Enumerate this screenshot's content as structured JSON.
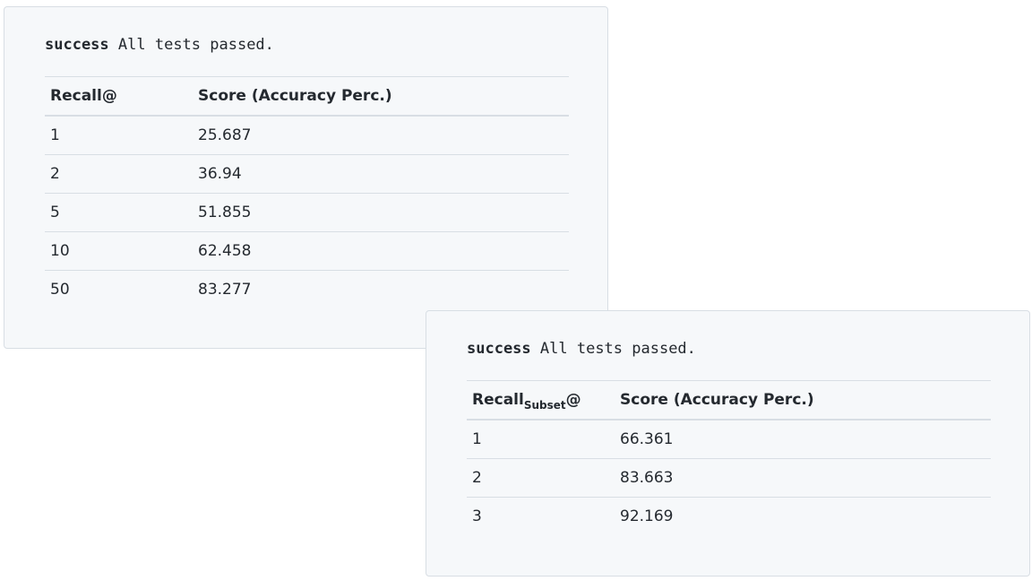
{
  "panels": [
    {
      "status_word": "success",
      "status_message": "All tests passed.",
      "headers": {
        "k_base": "Recall",
        "k_subscript": "",
        "k_suffix": "@",
        "score": "Score (Accuracy Perc.)"
      },
      "rows": [
        {
          "k": "1",
          "score": "25.687"
        },
        {
          "k": "2",
          "score": "36.94"
        },
        {
          "k": "5",
          "score": "51.855"
        },
        {
          "k": "10",
          "score": "62.458"
        },
        {
          "k": "50",
          "score": "83.277"
        }
      ]
    },
    {
      "status_word": "success",
      "status_message": "All tests passed.",
      "headers": {
        "k_base": "Recall",
        "k_subscript": "Subset",
        "k_suffix": "@",
        "score": "Score (Accuracy Perc.)"
      },
      "rows": [
        {
          "k": "1",
          "score": "66.361"
        },
        {
          "k": "2",
          "score": "83.663"
        },
        {
          "k": "3",
          "score": "92.169"
        }
      ]
    }
  ]
}
